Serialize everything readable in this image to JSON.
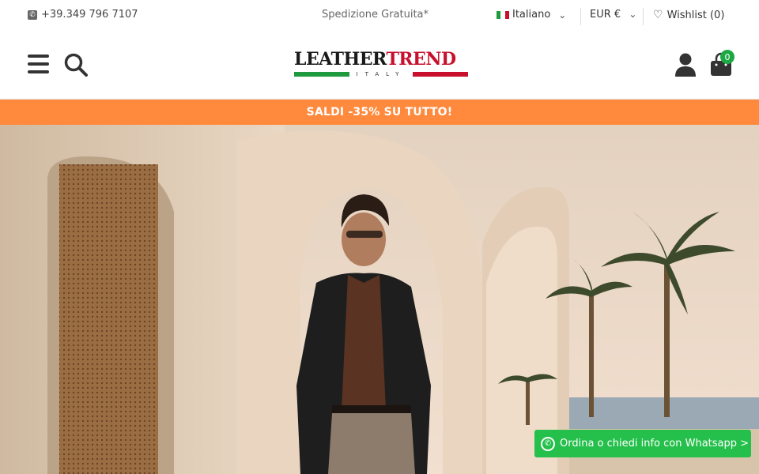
{
  "topbar": {
    "phone": "+39.349 796 7107",
    "shipping": "Spedizione Gratuita*",
    "language": "Italiano",
    "currency": "EUR €",
    "wishlist": "Wishlist (0)"
  },
  "header": {
    "logo_main": "LEATHER",
    "logo_accent": "TREND",
    "logo_sub": "ITALY",
    "cart_count": "0"
  },
  "promo": {
    "text": "SALDI -35% SU TUTTO!"
  },
  "whatsapp": {
    "label": "Ordina o chiedi info con Whatsapp >"
  },
  "colors": {
    "promo_bg": "#ff8a3d",
    "whatsapp_bg": "#25c04b",
    "badge_bg": "#1ea845",
    "flag_green": "#1f9a3e",
    "flag_red": "#c8102e"
  },
  "icons": {
    "phone": "phone-icon",
    "chevron": "chevron-down-icon",
    "wishlist": "heart-icon",
    "menu": "hamburger-menu-icon",
    "search": "search-icon",
    "account": "user-icon",
    "cart": "shopping-bag-icon",
    "whatsapp": "whatsapp-icon"
  }
}
